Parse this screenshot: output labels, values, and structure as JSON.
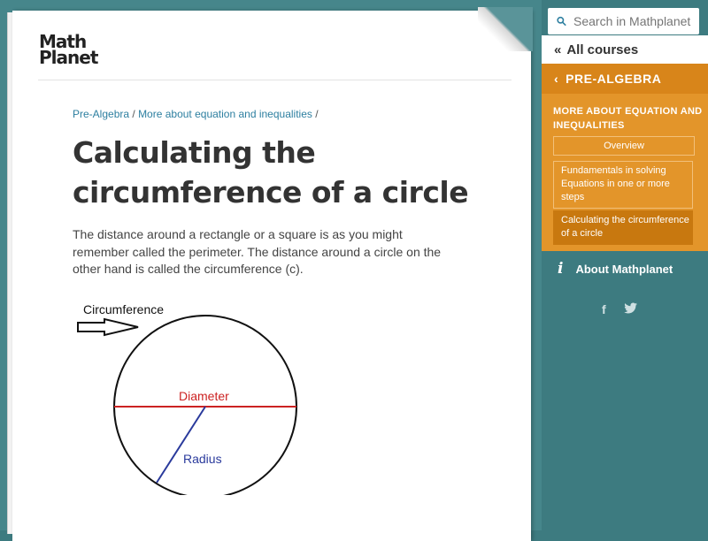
{
  "logo": {
    "line1": "Math",
    "line2": "Planet"
  },
  "breadcrumb": {
    "items": [
      "Pre-Algebra",
      "More about equation and inequalities"
    ],
    "sep": "/"
  },
  "page": {
    "title": "Calculating the circumference of a circle",
    "intro": "The distance around a rectangle or a square is as you might remember called the perimeter. The distance around a circle on the other hand is called the circumference (c)."
  },
  "figure": {
    "circumference_label": "Circumference",
    "diameter_label": "Diameter",
    "radius_label": "Radius"
  },
  "sidebar": {
    "search_placeholder": "Search in Mathplanet",
    "all_courses": "All courses",
    "course": "PRE-ALGEBRA",
    "section_title": "MORE ABOUT EQUATION AND INEQUALITIES",
    "overview": "Overview",
    "items": [
      "Fundamentals in solving Equations in one or more steps",
      "Calculating the circumference of a circle"
    ],
    "about": "About Mathplanet",
    "social": [
      "f",
      "twitter"
    ]
  },
  "colors": {
    "accent_orange": "#e3952a",
    "sidebar_teal": "#3d7b80",
    "link": "#2d7fa0",
    "diameter_red": "#cc2222",
    "radius_blue": "#2a3a9c"
  }
}
